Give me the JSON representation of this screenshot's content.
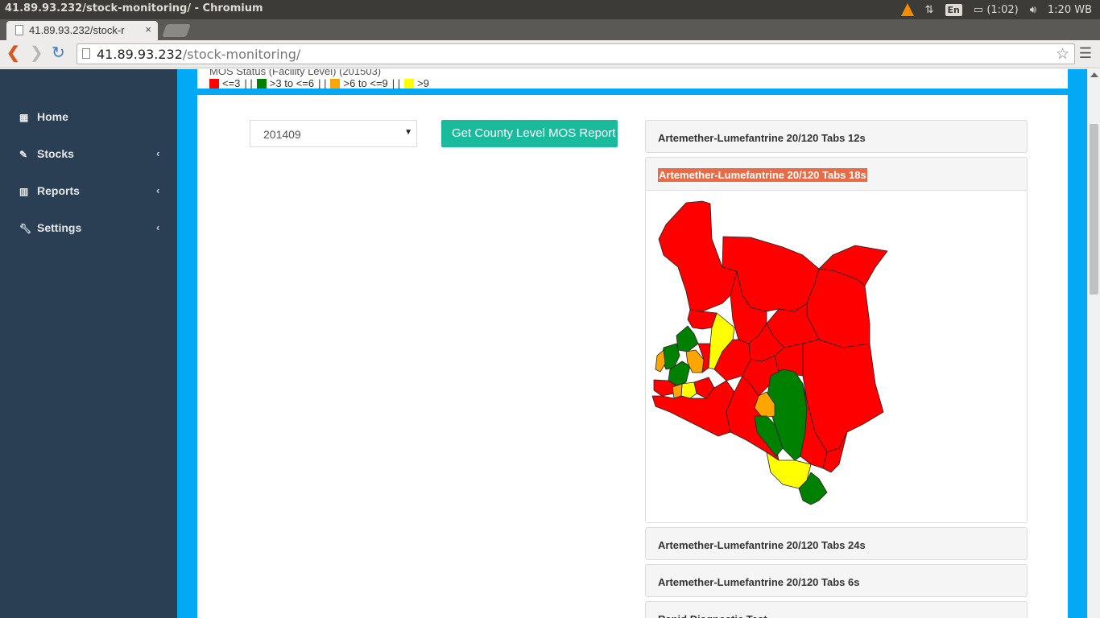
{
  "os": {
    "window_title": "41.89.93.232/stock-monitoring/ - Chromium",
    "keyboard": "En",
    "battery": "(1:02)",
    "clock": "1:20 WB"
  },
  "browser": {
    "tab_title": "41.89.93.232/stock-r",
    "tab_close": "×",
    "url_host": "41.89.93.232",
    "url_path": "/stock-monitoring/"
  },
  "sidebar": {
    "items": [
      {
        "label": "Home",
        "icon": "th-large-icon",
        "chevron": ""
      },
      {
        "label": "Stocks",
        "icon": "edit-icon",
        "chevron": "‹"
      },
      {
        "label": "Reports",
        "icon": "bar-chart-icon",
        "chevron": "‹"
      },
      {
        "label": "Settings",
        "icon": "wrench-icon",
        "chevron": "‹"
      }
    ]
  },
  "header": {
    "title": "MOS Status (Facility Level) (201503)",
    "legend": [
      {
        "label": "<=3",
        "color": "#ff0000"
      },
      {
        "label": ">3 to <=6",
        "color": "#008000"
      },
      {
        "label": ">6 to <=9",
        "color": "#ffa500"
      },
      {
        "label": ">9",
        "color": "#ffff00"
      }
    ],
    "separator": "| |"
  },
  "controls": {
    "period_value": "201409",
    "report_button": "Get County Level MOS Report"
  },
  "accordion": [
    {
      "title": "Artemether-Lumefantrine 20/120 Tabs 12s",
      "active": false
    },
    {
      "title": "Artemether-Lumefantrine 20/120 Tabs 18s",
      "active": true
    },
    {
      "title": "Artemether-Lumefantrine 20/120 Tabs 24s",
      "active": false
    },
    {
      "title": "Artemether-Lumefantrine 20/120 Tabs 6s",
      "active": false
    },
    {
      "title": "Rapid Diagnostic Test",
      "active": false
    }
  ],
  "map": {
    "region": "Kenya",
    "colors": {
      "red": "#ff0000",
      "green": "#008000",
      "orange": "#ffa500",
      "yellow": "#ffff00"
    }
  }
}
